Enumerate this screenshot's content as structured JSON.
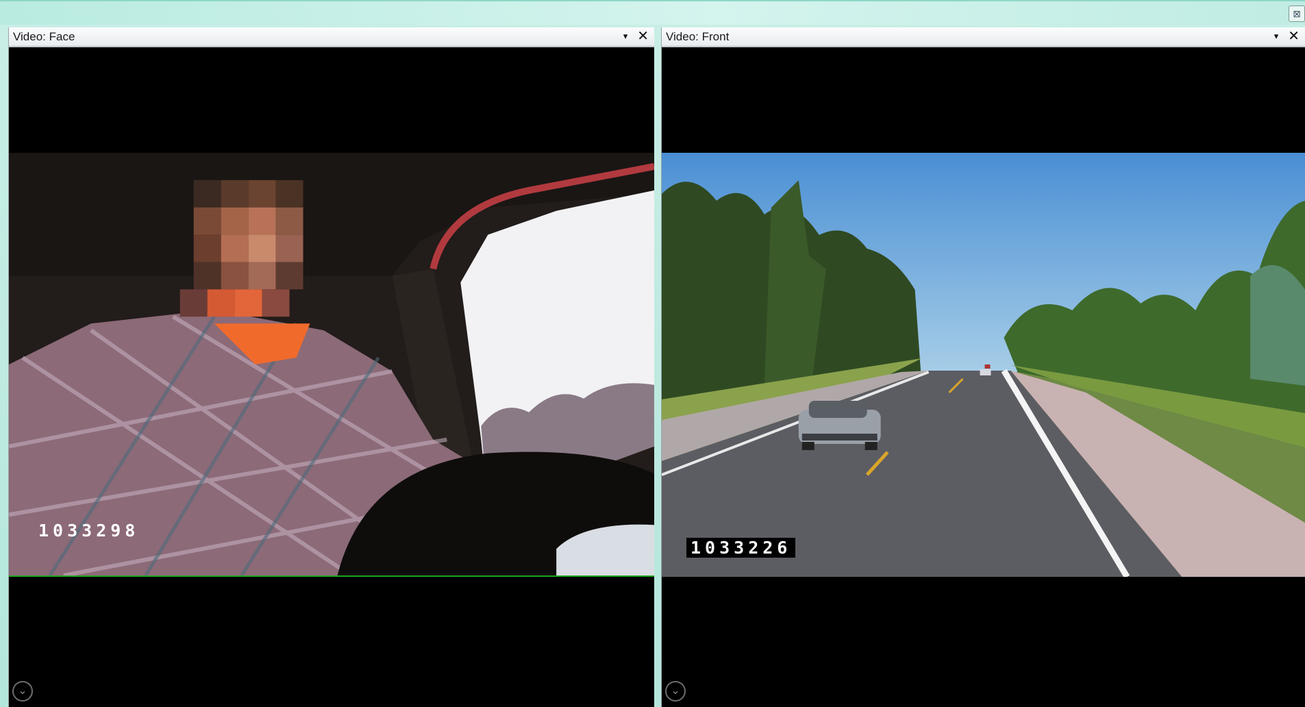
{
  "window": {
    "close_glyph": "⊠"
  },
  "panels": [
    {
      "title": "Video: Face",
      "frame_counter": "1033298",
      "dropdown_glyph": "▾",
      "close_glyph": "✕",
      "expand_glyph": "⌄"
    },
    {
      "title": "Video: Front",
      "frame_counter": "1033226",
      "dropdown_glyph": "▾",
      "close_glyph": "✕",
      "expand_glyph": "⌄"
    }
  ],
  "colors": {
    "desktop": "#b4e6dc",
    "video_bg": "#000000",
    "progress_line": "#1fa31f"
  },
  "icons": [
    "dropdown-arrow-icon",
    "close-icon",
    "expand-chevron-icon",
    "window-close-icon"
  ]
}
